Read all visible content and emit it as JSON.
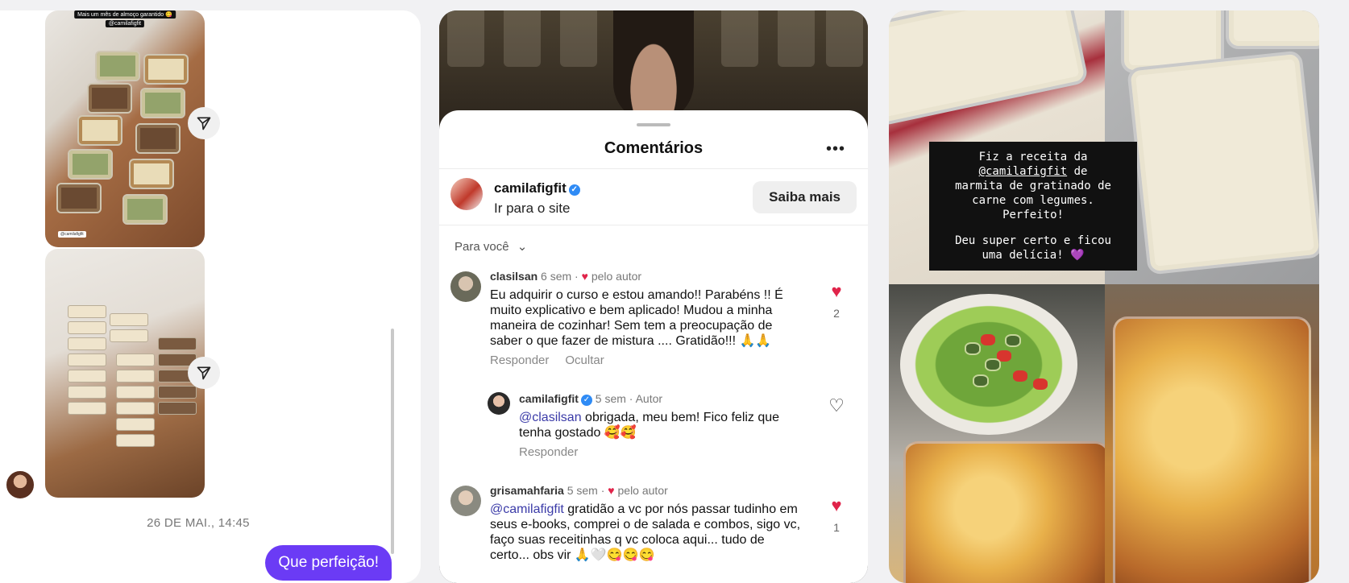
{
  "dm_panel": {
    "story_caption_1": "Mais um mês de almoço garantido 😋",
    "story_caption_2": "@camilafigfit",
    "story_tag": "@camilafigfit",
    "date_divider": "26 DE MAI., 14:45",
    "sent_message": "Que perfeição!"
  },
  "comments_panel": {
    "title": "Comentários",
    "ad": {
      "username": "camilafigfit",
      "subtitle": "Ir para o site",
      "button": "Saiba mais"
    },
    "filter": "Para você",
    "comments": [
      {
        "username": "clasilsan",
        "time": "6 sem",
        "liked_by_author": "pelo autor",
        "text": "Eu adquirir o curso e estou amando!! Parabéns !! É muito explicativo e bem aplicado! Mudou a minha maneira de cozinhar! Sem tem a preocupação de saber o que fazer de mistura .... Gratidão!!! 🙏🙏",
        "reply": "Responder",
        "hide": "Ocultar",
        "likes": "2"
      },
      {
        "username": "camilafigfit",
        "time": "5 sem",
        "badge": "Autor",
        "mention": "@clasilsan",
        "text": " obrigada, meu bem! Fico feliz que tenha gostado 🥰🥰",
        "reply": "Responder"
      },
      {
        "username": "grisamahfaria",
        "time": "5 sem",
        "liked_by_author": "pelo autor",
        "mention": "@camilafigfit",
        "text": " gratidão a vc por nós passar tudinho em seus e-books, comprei o de salada e combos, sigo vc, faço suas receitinhas q vc coloca aqui... tudo de certo... obs vir 🙏🤍😋😋😋",
        "likes": "1"
      }
    ]
  },
  "story_panel": {
    "line1": "Fiz a receita da",
    "mention": "@camilafigfit",
    "line2_suffix": " de",
    "line3": "marmita de gratinado de",
    "line4": "carne com legumes.",
    "line5": "Perfeito!",
    "line6": "Deu super certo e ficou",
    "line7": "uma delícia! 💜"
  },
  "colors": {
    "bubble": "#6b3bf5",
    "like_red": "#e0244a",
    "verified": "#2f8bf5",
    "mention": "#3b3ba8"
  }
}
